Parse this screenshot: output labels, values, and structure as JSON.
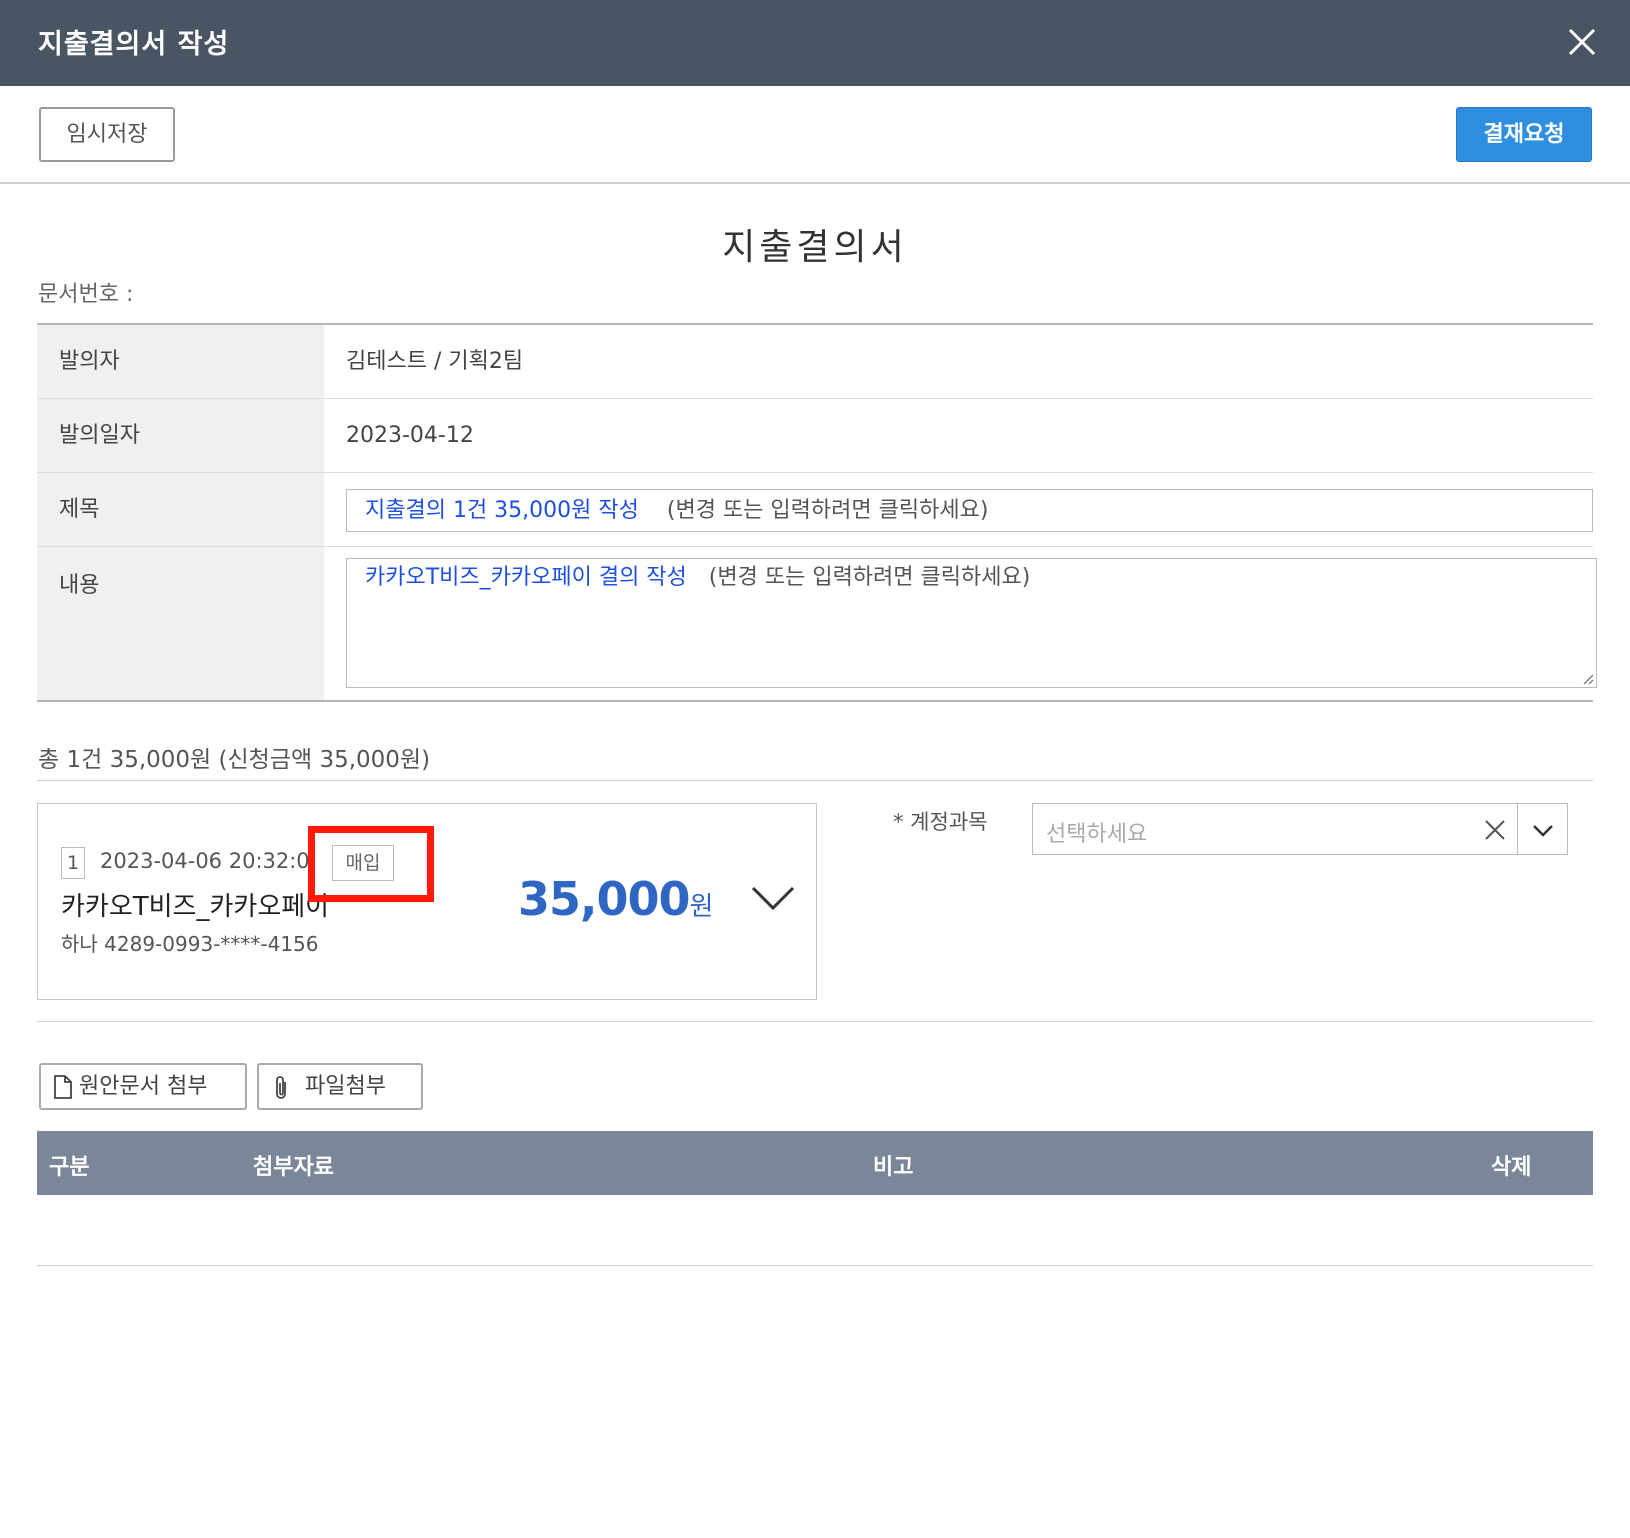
{
  "window": {
    "title": "지출결의서 작성"
  },
  "toolbar": {
    "temp_save": "임시저장",
    "approve_request": "결재요청"
  },
  "document": {
    "title": "지출결의서",
    "doc_number_label": "문서번호 :",
    "fields": {
      "proposer_label": "발의자",
      "proposer_value": "김테스트 / 기획2팀",
      "date_label": "발의일자",
      "date_value": "2023-04-12",
      "subject_label": "제목",
      "subject_value": "지출결의 1건 35,000원 작성",
      "subject_hint": "(변경 또는 입력하려면 클릭하세요)",
      "content_label": "내용",
      "content_value": "카카오T비즈_카카오페이 결의 작성",
      "content_hint": "(변경 또는 입력하려면 클릭하세요)"
    }
  },
  "summary": {
    "text": "총 1건 35,000원 (신청금액 35,000원)"
  },
  "card": {
    "index": "1",
    "datetime": "2023-04-06 20:32:0",
    "badge": "매입",
    "merchant": "카카오T비즈_카카오페이",
    "account": "하나 4289-0993-****-4156",
    "amount": "35,000",
    "currency": "원"
  },
  "account_subject": {
    "label": "* 계정과목",
    "placeholder": "선택하세요"
  },
  "attachments": {
    "original_doc_button": "원안문서 첨부",
    "file_button": "파일첨부",
    "columns": [
      "구분",
      "첨부자료",
      "비고",
      "삭제"
    ]
  },
  "colors": {
    "titlebar": "#4a5563",
    "approve_button": "#2e8fe0",
    "amount": "#2f66c4",
    "highlight_box": "#ff1a0a",
    "grid_header": "#7a8799"
  },
  "icons": [
    "close-icon",
    "chevron-down-icon",
    "clear-icon",
    "document-icon",
    "paperclip-icon",
    "resize-handle-icon"
  ]
}
